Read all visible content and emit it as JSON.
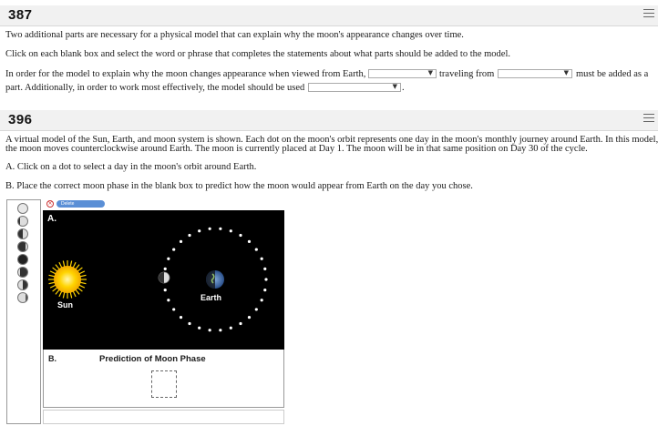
{
  "q1": {
    "number": "387",
    "line1": "Two additional parts are necessary for a physical model that can explain why the moon's appearance changes over time.",
    "line2": "Click on each blank box and select the word or phrase that completes the statements about what parts should be added to the model.",
    "s1_a": "In order for the model to explain why the moon changes appearance when viewed from Earth,",
    "s1_b": "traveling from",
    "s1_c": "must be added as a",
    "s2_a": "part. Additionally, in order to work most effectively, the model should be used",
    "s2_end": "."
  },
  "q2": {
    "number": "396",
    "intro1": "A virtual model of the Sun, Earth, and moon system is shown. Each dot on the moon's orbit represents one day in the moon's monthly journey around Earth. In this model,",
    "intro2": "the moon moves counterclockwise around Earth. The moon is currently placed at Day 1. The moon will be in that same position on Day 30 of the cycle.",
    "stepA": "A. Click on a dot to select a day in the moon's orbit around Earth.",
    "stepB": "B. Place the correct moon phase in the blank box to predict how the moon would appear from Earth on the day you chose."
  },
  "sim": {
    "delete_label": "Delete",
    "panel_a_label": "A.",
    "panel_b_label": "B.",
    "sun_label": "Sun",
    "earth_label": "Earth",
    "prediction_title": "Prediction of Moon Phase",
    "orbit_dot_count": 30,
    "palette_phases": [
      "full",
      "waxing-gibbous",
      "first-quarter",
      "waxing-crescent",
      "new",
      "waning-crescent",
      "third-quarter",
      "waning-gibbous"
    ]
  },
  "colors": {
    "panel_bg": "#000000",
    "sun": "#f5c400",
    "delete_button": "#5a8fd6"
  }
}
